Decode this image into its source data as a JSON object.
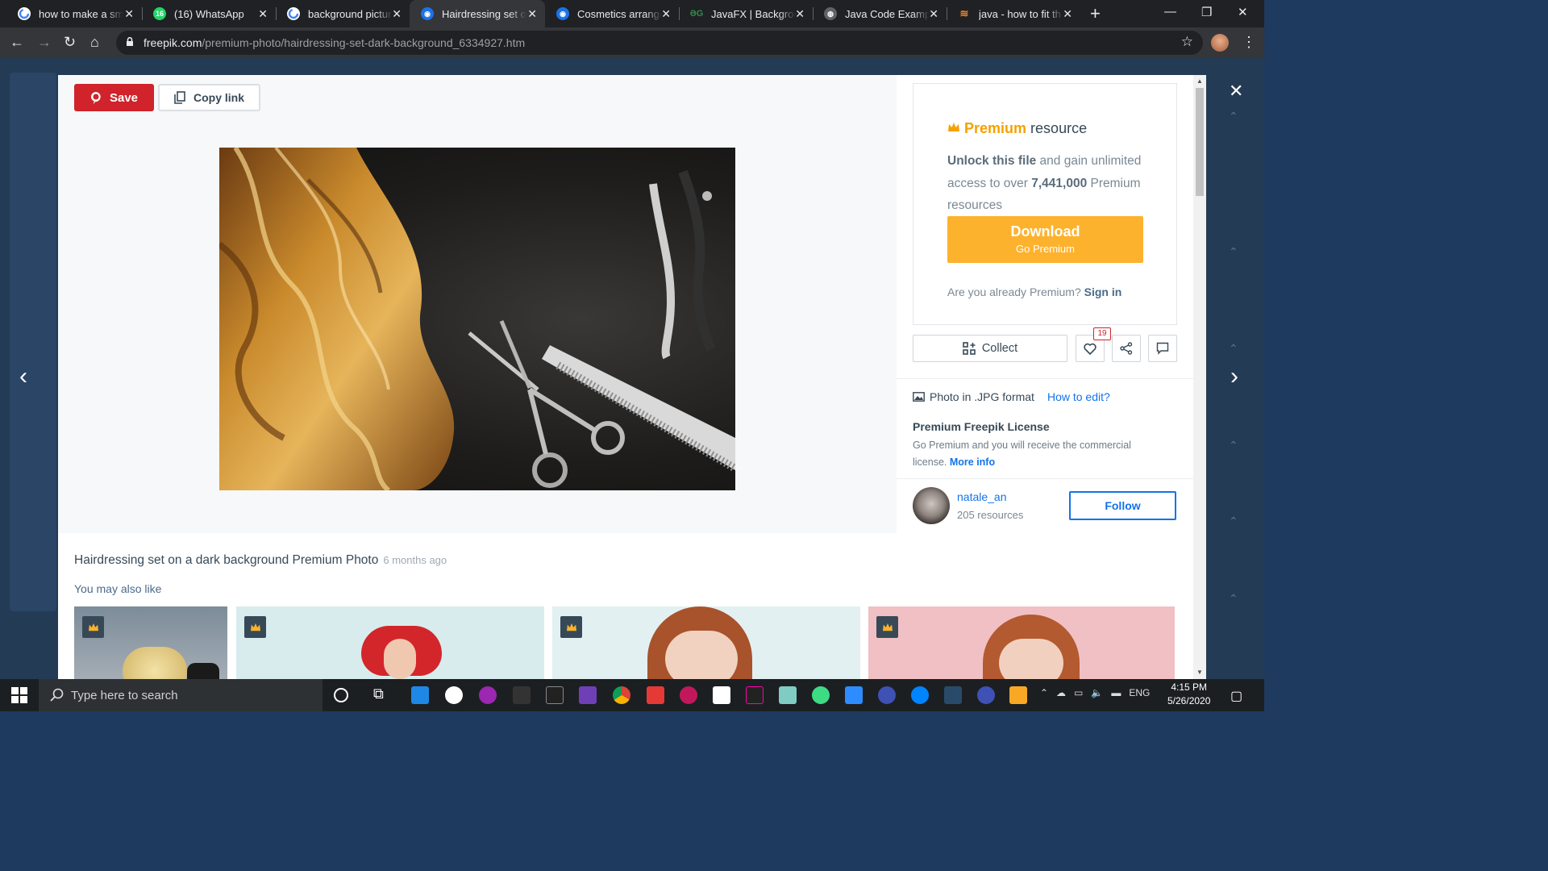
{
  "browser": {
    "tabs": [
      {
        "title": "how to make a sm",
        "favicon": "google-icon"
      },
      {
        "title": "(16) WhatsApp",
        "favicon": "whatsapp-icon"
      },
      {
        "title": "background pictur",
        "favicon": "google-icon"
      },
      {
        "title": "Hairdressing set o",
        "favicon": "freepik-icon",
        "active": true
      },
      {
        "title": "Cosmetics arrange",
        "favicon": "freepik-icon"
      },
      {
        "title": "JavaFX | Backgrou",
        "favicon": "gfg-icon"
      },
      {
        "title": "Java Code Example",
        "favicon": "globe-icon"
      },
      {
        "title": "java - how to fit th",
        "favicon": "stackoverflow-icon"
      }
    ],
    "url_host": "freepik.com",
    "url_path": "/premium-photo/hairdressing-set-dark-background_6334927.htm"
  },
  "toolbar": {
    "save_label": "Save",
    "copy_label": "Copy link"
  },
  "premium": {
    "title_accent": "Premium",
    "title_rest": " resource",
    "unlock_bold": "Unlock this file",
    "unlock_rest": " and gain unlimited access to over ",
    "count": "7,441,000",
    "count_rest": " Premium resources",
    "download_label": "Download",
    "download_sub": "Go Premium",
    "already": "Are you already Premium? ",
    "signin": "Sign in"
  },
  "actions": {
    "collect_label": "Collect",
    "like_count": "19"
  },
  "file": {
    "format": "Photo in .JPG format",
    "howto": "How to edit?",
    "license_title": "Premium Freepik License",
    "license_desc": "Go Premium and you will receive the commercial license. ",
    "more_info": "More info"
  },
  "author": {
    "name": "natale_an",
    "resources": "205 resources",
    "follow_label": "Follow"
  },
  "photo_title": "Hairdressing set on a dark background Premium Photo",
  "photo_age": "6 months ago",
  "related_heading": "You may also like",
  "colors": {
    "accent_red": "#d0232b",
    "premium_gold": "#fdb22e",
    "link_blue": "#1273eb"
  },
  "taskbar": {
    "search_placeholder": "Type here to search",
    "lang": "ENG",
    "time": "4:15 PM",
    "date": "5/26/2020"
  }
}
